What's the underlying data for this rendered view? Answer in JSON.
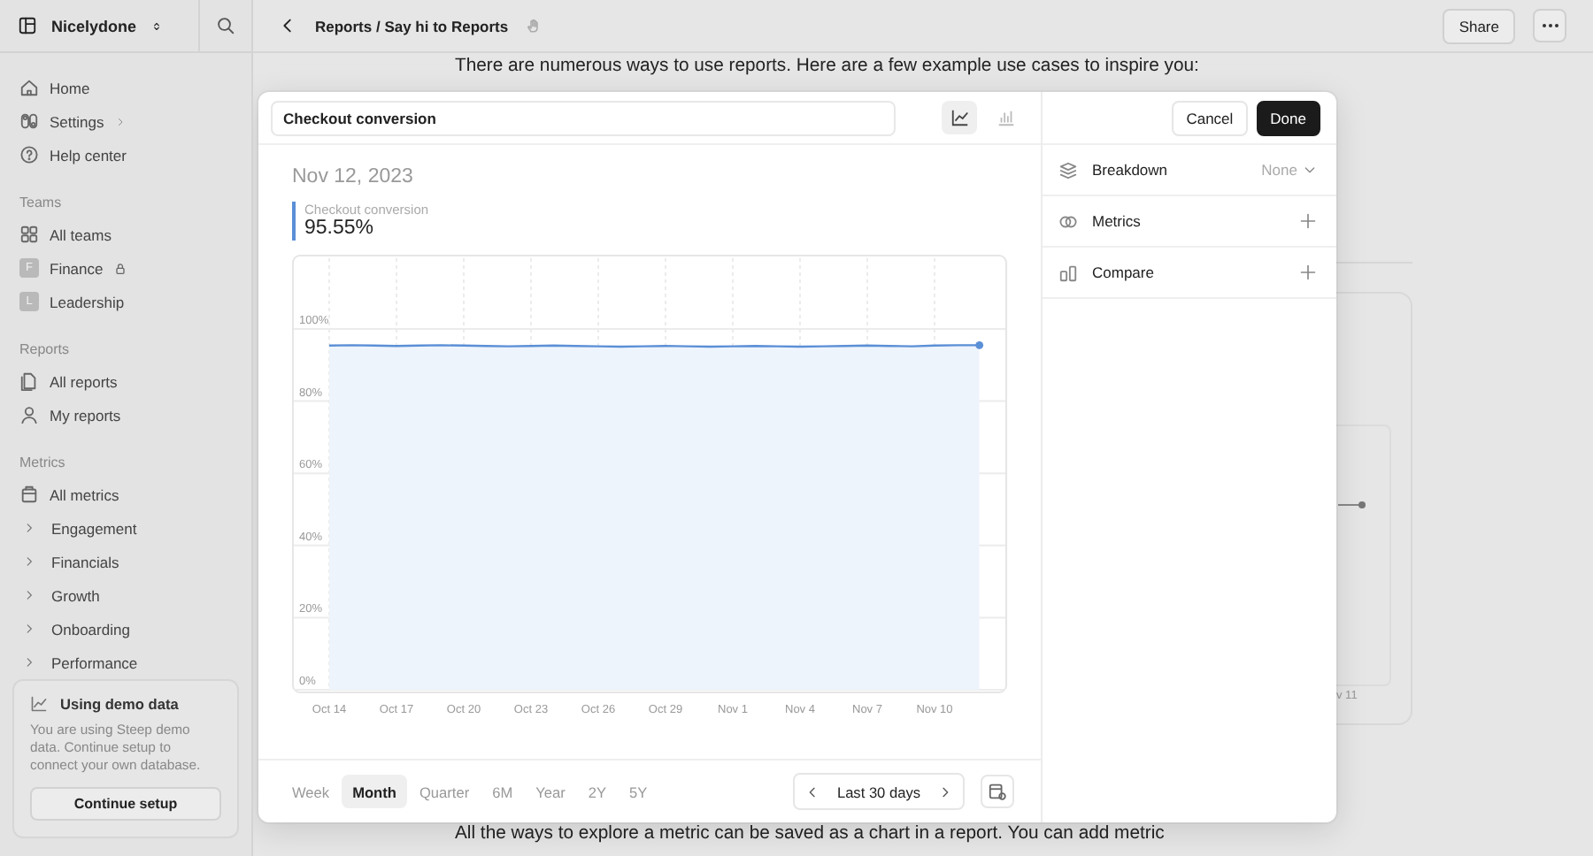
{
  "sidebar": {
    "workspace": "Nicelydone",
    "top_items": [
      {
        "label": "Home",
        "has_submenu": false
      },
      {
        "label": "Settings",
        "has_submenu": true
      },
      {
        "label": "Help center",
        "has_submenu": false
      }
    ],
    "sections": [
      {
        "heading": "Teams",
        "items": [
          {
            "label": "All teams"
          },
          {
            "label": "Finance",
            "badge": "F",
            "locked": true
          },
          {
            "label": "Leadership",
            "badge": "L",
            "locked": false
          }
        ]
      },
      {
        "heading": "Reports",
        "items": [
          {
            "label": "All reports"
          },
          {
            "label": "My reports"
          }
        ]
      },
      {
        "heading": "Metrics",
        "items": [
          {
            "label": "All metrics"
          },
          {
            "label": "Engagement",
            "expanded": false
          },
          {
            "label": "Financials",
            "expanded": false
          },
          {
            "label": "Growth",
            "expanded": false
          },
          {
            "label": "Onboarding",
            "expanded": false
          },
          {
            "label": "Performance",
            "expanded": false
          }
        ]
      }
    ],
    "demo_card": {
      "title": "Using demo data",
      "text": "You are using Steep demo data. Continue setup to connect your own database.",
      "button": "Continue setup"
    }
  },
  "topbar": {
    "breadcrumb": "Reports / Say hi to Reports",
    "share": "Share"
  },
  "document": {
    "intro": "There are numerous ways to use reports. Here are a few example use cases to inspire you:",
    "outro": "All the ways to explore a metric can be saved as a chart in a report. You can add metric",
    "background_chart_label": "v 11"
  },
  "modal": {
    "metric_field": {
      "value": "Checkout conversion"
    },
    "chart_types": [
      {
        "kind": "line",
        "selected": true
      },
      {
        "kind": "bar",
        "selected": false
      }
    ],
    "buttons": {
      "cancel": "Cancel",
      "done": "Done"
    },
    "options": [
      {
        "kind": "select",
        "label": "Breakdown",
        "value": "None"
      },
      {
        "kind": "add",
        "label": "Metrics"
      },
      {
        "kind": "add",
        "label": "Compare"
      }
    ],
    "date": "Nov 12, 2023",
    "legend": {
      "value": "95.55%"
    },
    "chart_data": {
      "type": "line",
      "categories": [
        "Oct 14",
        null,
        null,
        "Oct 17",
        null,
        null,
        "Oct 20",
        null,
        null,
        "Oct 23",
        null,
        null,
        "Oct 26",
        null,
        null,
        "Oct 29",
        null,
        null,
        "Nov 1",
        null,
        null,
        "Nov 4",
        null,
        null,
        "Nov 7",
        null,
        null,
        "Nov 10",
        null,
        null
      ],
      "series": [
        {
          "name": "Checkout conversion",
          "color": "#5b8fd6",
          "values": [
            95.4,
            95.5,
            95.4,
            95.3,
            95.4,
            95.5,
            95.4,
            95.3,
            95.2,
            95.3,
            95.4,
            95.3,
            95.2,
            95.1,
            95.2,
            95.3,
            95.2,
            95.1,
            95.2,
            95.3,
            95.2,
            95.1,
            95.2,
            95.3,
            95.4,
            95.3,
            95.2,
            95.4,
            95.5,
            95.5
          ]
        }
      ],
      "ylim": [
        0,
        100
      ],
      "grid": true,
      "yticks": [
        {
          "value": 0,
          "label": "0%"
        },
        {
          "value": 20,
          "label": "20%"
        },
        {
          "value": 40,
          "label": "40%"
        },
        {
          "value": 60,
          "label": "60%"
        },
        {
          "value": 80,
          "label": "80%"
        },
        {
          "value": 100,
          "label": "100%"
        }
      ]
    },
    "periods": [
      {
        "label": "Week",
        "selected": false
      },
      {
        "label": "Month",
        "selected": true
      },
      {
        "label": "Quarter",
        "selected": false
      },
      {
        "label": "6M",
        "selected": false
      },
      {
        "label": "Year",
        "selected": false
      },
      {
        "label": "2Y",
        "selected": false
      },
      {
        "label": "5Y",
        "selected": false
      }
    ],
    "range": {
      "label": "Last 30 days"
    }
  }
}
